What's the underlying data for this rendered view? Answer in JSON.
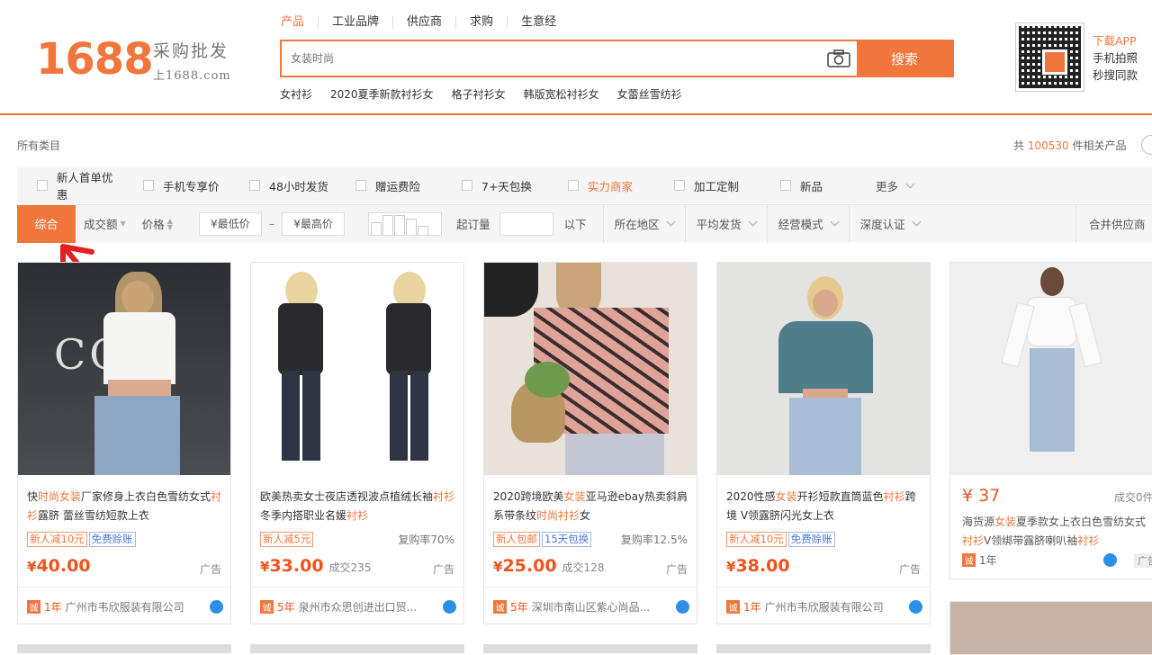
{
  "logo": {
    "main": "1688",
    "sub1": "采购批发",
    "sub2": "上1688.com"
  },
  "search": {
    "tabs": [
      "产品",
      "工业品牌",
      "供应商",
      "求购",
      "生意经"
    ],
    "placeholder": "女装时尚",
    "button": "搜索",
    "hot_words": [
      "女衬衫",
      "2020夏季新款衬衫女",
      "格子衬衫女",
      "韩版宽松衬衫女",
      "女蕾丝雪纺衫"
    ]
  },
  "app_promo": {
    "line1": "下载APP",
    "line2": "手机拍照",
    "line3": "秒搜同款"
  },
  "breadcrumb": "所有类目",
  "result_count": {
    "prefix": "共 ",
    "num": "100530",
    "suffix": " 件相关产品"
  },
  "filters": {
    "checks": [
      "新人首单优惠",
      "手机专享价",
      "48小时发货",
      "赠运费险",
      "7+天包换",
      "实力商家",
      "加工定制",
      "新品"
    ],
    "more": "更多"
  },
  "sort": {
    "main": "综合",
    "volume": "成交额",
    "price": "价格",
    "min_price": "¥最低价",
    "dash": "–",
    "max_price": "¥最高价",
    "moq_label": "起订量",
    "moq_unit": "以下",
    "dropdowns": [
      "所在地区",
      "平均发货",
      "经营模式",
      "深度认证"
    ],
    "merge": "合并供应商"
  },
  "products": [
    {
      "title_parts": [
        "快",
        "时尚女装",
        "厂家修身上衣白色雪纺女式",
        "衬衫",
        "露脐 蕾丝雪纺短款上衣"
      ],
      "tags": [
        [
          "red",
          "新人减10元"
        ],
        [
          "blue",
          "免费赊账"
        ]
      ],
      "repurchase": "",
      "price_symbol": "¥",
      "price": "40.00",
      "sold": "",
      "ad": "广告",
      "years": "1年",
      "company": "广州市韦欣服装有限公司"
    },
    {
      "title_parts": [
        "欧美热卖女士夜店透视波点植绒长袖",
        "衬衫",
        " 冬季内搭职业名媛",
        "衬衫",
        ""
      ],
      "tags": [
        [
          "red",
          "新人减5元"
        ]
      ],
      "repurchase": "复购率70%",
      "price_symbol": "¥",
      "price": "33.00",
      "sold": "成交235",
      "ad": "广告",
      "years": "5年",
      "company": "泉州市众思创进出口贸..."
    },
    {
      "title_parts": [
        "2020跨境欧美",
        "女装",
        "亚马逊ebay热卖斜肩系带条纹",
        "时尚衬衫",
        "女"
      ],
      "tags": [
        [
          "red",
          "新人包邮"
        ],
        [
          "blue",
          "15天包换"
        ]
      ],
      "repurchase": "复购率12.5%",
      "price_symbol": "¥",
      "price": "25.00",
      "sold": "成交128",
      "ad": "广告",
      "years": "5年",
      "company": "深圳市南山区紫心尚品..."
    },
    {
      "title_parts": [
        "2020性感",
        "女装",
        "开衫短款直筒蓝色",
        "衬衫",
        "跨境 V领露脐闪光女上衣"
      ],
      "tags": [
        [
          "red",
          "新人减10元"
        ],
        [
          "blue",
          "免费赊账"
        ]
      ],
      "repurchase": "",
      "price_symbol": "¥",
      "price": "38.00",
      "sold": "",
      "ad": "广告",
      "years": "1年",
      "company": "广州市韦欣服装有限公司"
    }
  ],
  "product5": {
    "price": "¥ 37",
    "sold": "成交0件",
    "title_parts": [
      "海货源",
      "女装",
      "夏季款女上衣白色雪纺女式",
      "衬衫",
      "V领绑带露脐喇叭袖",
      "衬衫"
    ],
    "years": "1年",
    "ad": "广告"
  }
}
